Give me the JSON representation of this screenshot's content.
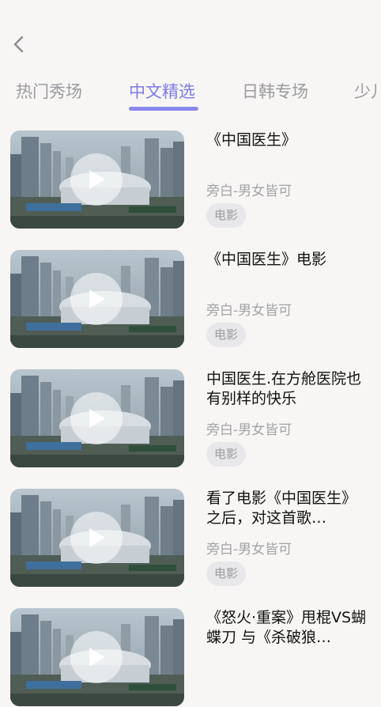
{
  "header": {
    "back_icon": "chevron-left-icon"
  },
  "tabs": [
    {
      "label": "热门秀场",
      "active": false
    },
    {
      "label": "中文精选",
      "active": true
    },
    {
      "label": "日韩专场",
      "active": false
    },
    {
      "label": "少儿",
      "active": false
    }
  ],
  "accent_color": "#7d7be6",
  "items": [
    {
      "title": "《中国医生》",
      "subtitle": "旁白-男女皆可",
      "tag": "电影"
    },
    {
      "title": "《中国医生》电影",
      "subtitle": "旁白-男女皆可",
      "tag": "电影"
    },
    {
      "title": "中国医生.在方舱医院也有别样的快乐",
      "subtitle": "旁白-男女皆可",
      "tag": "电影"
    },
    {
      "title": "看了电影《中国医生》之后，对这首歌…",
      "subtitle": "旁白-男女皆可",
      "tag": "电影"
    },
    {
      "title": "《怒火·重案》甩棍VS蝴蝶刀 与《杀破狼…",
      "subtitle": "",
      "tag": ""
    }
  ]
}
